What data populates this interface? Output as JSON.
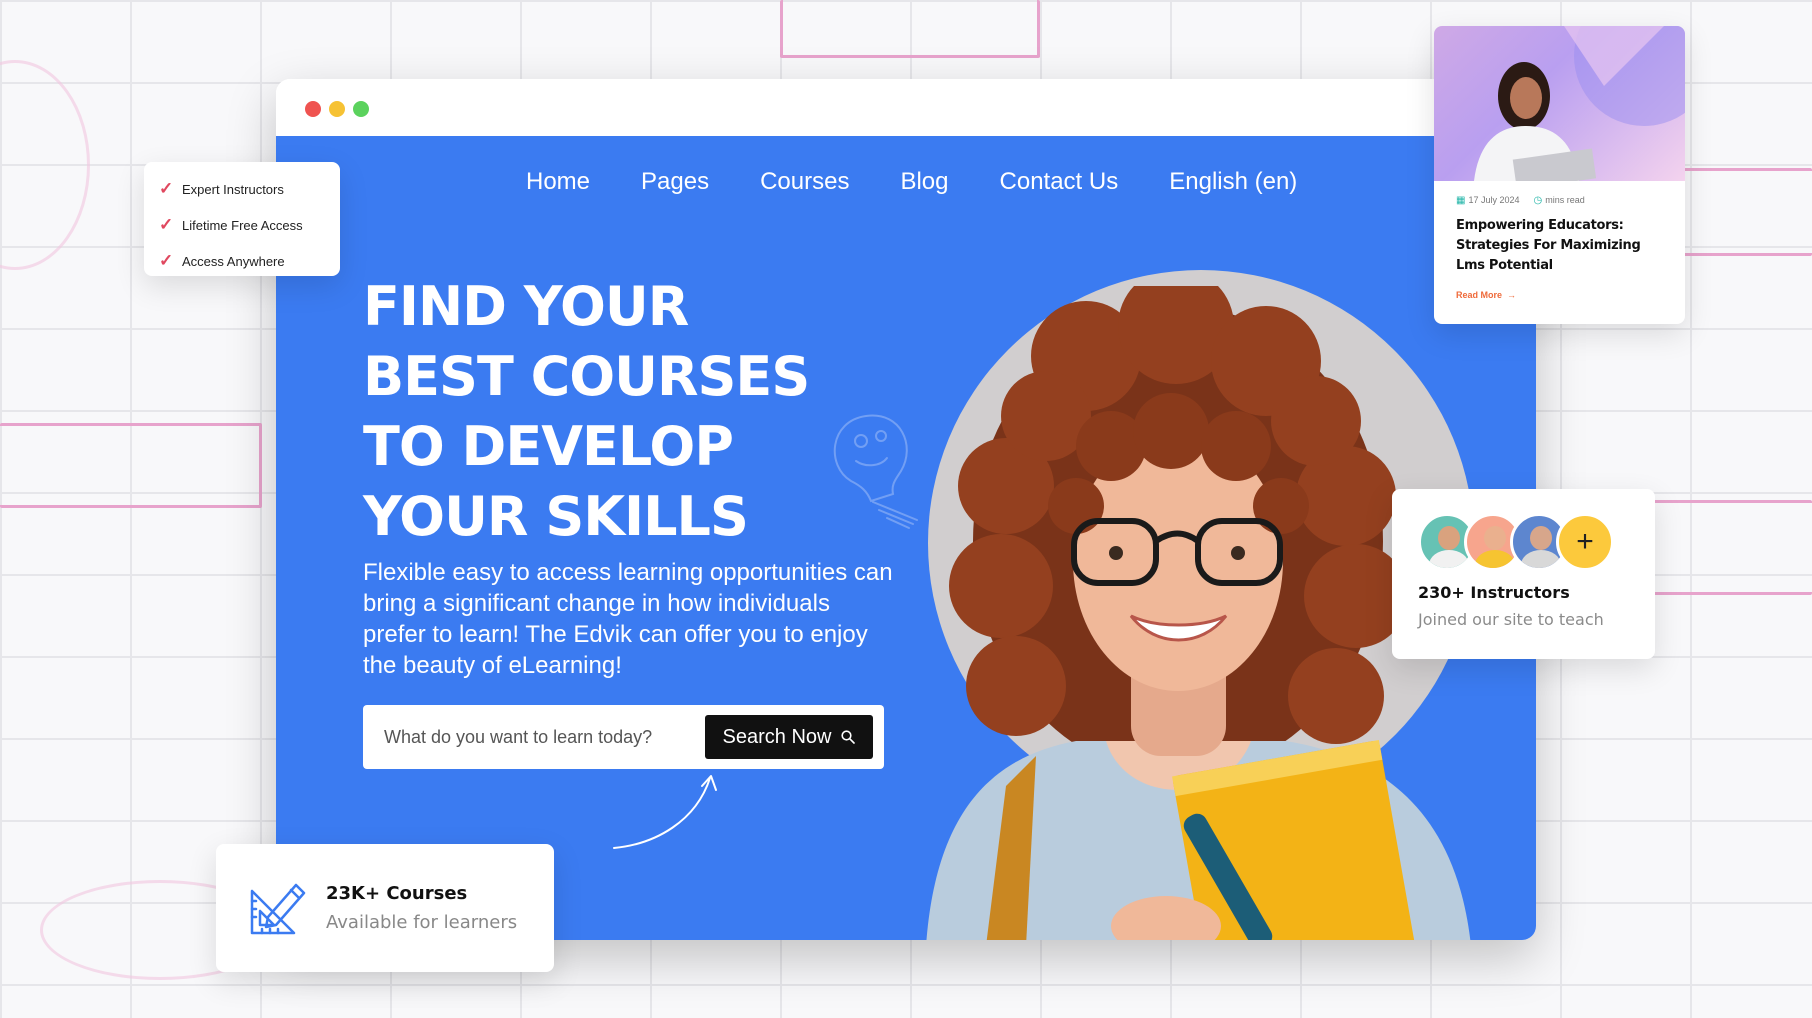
{
  "window": {
    "controls": [
      "close",
      "minimize",
      "maximize"
    ]
  },
  "nav": {
    "home": "Home",
    "pages": "Pages",
    "courses": "Courses",
    "blog": "Blog",
    "contact": "Contact Us",
    "language": "English (en)"
  },
  "hero": {
    "headline": [
      "FIND YOUR",
      "BEST COURSES",
      "TO DEVELOP",
      "YOUR SKILLS"
    ],
    "lead": "Flexible easy to access learning opportunities can bring a significant change in how individuals prefer to learn! The Edvik can offer you to enjoy the beauty of eLearning!",
    "search": {
      "placeholder": "What do you want to learn today?",
      "button_label": "Search Now",
      "button_icon": "search-icon"
    }
  },
  "features": {
    "items": [
      "Expert Instructors",
      "Lifetime Free Access",
      "Access Anywhere"
    ],
    "icon": "check-icon"
  },
  "courses_stat": {
    "title": "23K+ Courses",
    "subtitle": "Available for learners",
    "icon": "pencil-ruler-icon"
  },
  "instructors_stat": {
    "title": "230+ Instructors",
    "subtitle": "Joined our site to teach",
    "plus": "+"
  },
  "blog_card": {
    "date": "17 July 2024",
    "read_time": "mins read",
    "title": "Empowering Educators: Strategies For Maximizing Lms Potential",
    "read_more": "Read More",
    "read_more_icon": "arrow-right-icon"
  },
  "colors": {
    "hero_bg": "#3b7bf1",
    "button_bg": "#111111",
    "accent_check": "#e0485f",
    "plus_bg": "#fcc93c"
  }
}
